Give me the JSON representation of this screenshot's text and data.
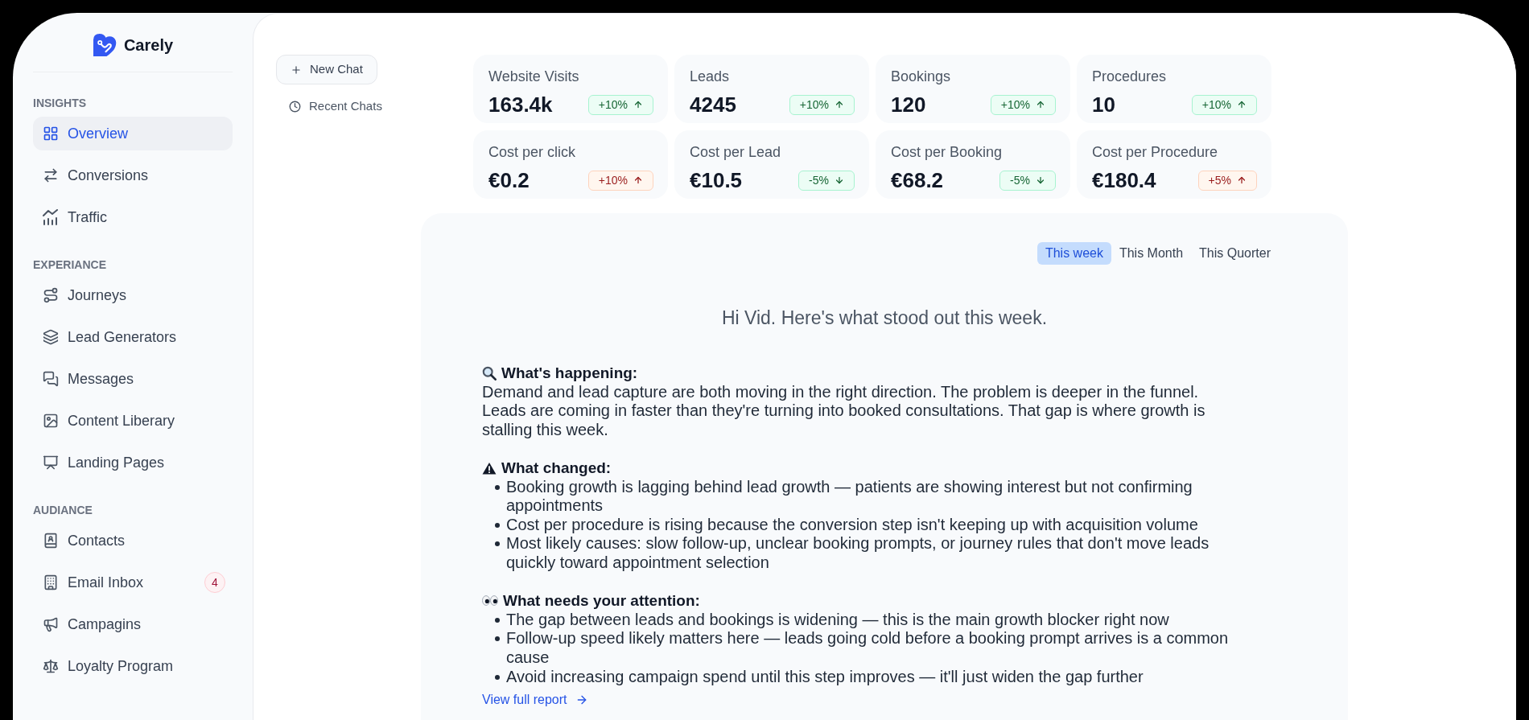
{
  "sidebar": {
    "brand": "Carely",
    "sections": [
      {
        "heading": "INSIGHTS",
        "items": [
          {
            "label": "Overview",
            "selected": true
          },
          {
            "label": "Conversions",
            "selected": false
          },
          {
            "label": "Traffic",
            "selected": false
          }
        ]
      },
      {
        "heading": "EXPERIANCE",
        "items": [
          {
            "label": "Journeys",
            "selected": false
          },
          {
            "label": "Lead Generators",
            "selected": false
          },
          {
            "label": "Messages",
            "selected": false
          },
          {
            "label": "Content Liberary",
            "selected": false
          },
          {
            "label": "Landing Pages",
            "selected": false
          }
        ]
      },
      {
        "heading": "AUDIANCE",
        "items": [
          {
            "label": "Contacts",
            "selected": false
          },
          {
            "label": "Email Inbox",
            "selected": false,
            "badge": "4"
          },
          {
            "label": "Campagins",
            "selected": false
          },
          {
            "label": "Loyalty Program",
            "selected": false
          }
        ]
      }
    ]
  },
  "chat": {
    "new_chat": "New Chat",
    "recent_chats": "Recent Chats"
  },
  "metrics": [
    {
      "label": "Website Visits",
      "value": "163.4k",
      "change": "+10%",
      "rising": true,
      "favorable": true
    },
    {
      "label": "Leads",
      "value": "4245",
      "change": "+10%",
      "rising": true,
      "favorable": true
    },
    {
      "label": "Bookings",
      "value": "120",
      "change": "+10%",
      "rising": true,
      "favorable": true
    },
    {
      "label": "Procedures",
      "value": "10",
      "change": "+10%",
      "rising": true,
      "favorable": true
    },
    {
      "label": "Cost per click",
      "value": "€0.2",
      "change": "+10%",
      "rising": true,
      "favorable": false
    },
    {
      "label": "Cost per Lead",
      "value": "€10.5",
      "change": "-5%",
      "rising": false,
      "favorable": true
    },
    {
      "label": "Cost per Booking",
      "value": "€68.2",
      "change": "-5%",
      "rising": false,
      "favorable": true
    },
    {
      "label": "Cost per Procedure",
      "value": "€180.4",
      "change": "+5%",
      "rising": true,
      "favorable": false
    }
  ],
  "summary": {
    "tabs": [
      {
        "label": "This week",
        "selected": true
      },
      {
        "label": "This Month",
        "selected": false
      },
      {
        "label": "This Quorter",
        "selected": false
      }
    ],
    "greeting": "Hi Vid. Here's what stood out this week.",
    "sections": [
      {
        "kind": "paragraph",
        "heading": "What's happening:",
        "text": "Demand and lead capture are both moving in the right direction. The problem is deeper in the funnel. Leads are coming in faster than they're turning into booked consultations. That gap is where growth is stalling this week."
      },
      {
        "kind": "bullets",
        "heading": "What changed:",
        "bullets": [
          "Booking growth is lagging behind lead growth — patients are showing interest but not confirming appointments",
          "Cost per procedure is rising because the conversion step isn't keeping up with acquisition volume",
          "Most likely causes: slow follow-up, unclear booking prompts, or journey rules that don't move leads quickly toward appointment selection"
        ]
      },
      {
        "kind": "bullets",
        "heading": "What needs your attention:",
        "bullets": [
          "The gap between leads and bookings is widening — this is the main growth blocker right now",
          "Follow-up speed likely matters here — leads going cold before a booking prompt arrives is a common cause",
          "Avoid increasing campaign spend until this step improves — it'll just widen the gap further"
        ]
      }
    ],
    "report_link": "View full report"
  }
}
